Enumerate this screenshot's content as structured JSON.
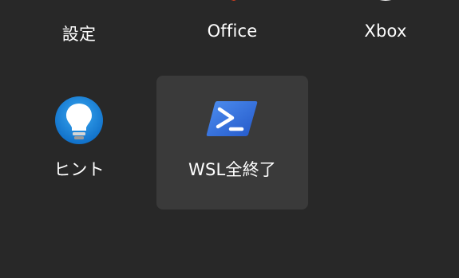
{
  "apps": [
    {
      "label": "設定",
      "icon": "settings-gear-icon"
    },
    {
      "label": "Office",
      "icon": "office-icon"
    },
    {
      "label": "Xbox",
      "icon": "xbox-icon"
    },
    {
      "label": "ヒント",
      "icon": "tips-lightbulb-icon"
    },
    {
      "label": "WSL全終了",
      "icon": "powershell-icon"
    }
  ],
  "colors": {
    "background": "#282828",
    "selected_tile": "#3a3a3a",
    "tips_blue": "#1a8fe0",
    "powershell_blue": "#2f6fdc",
    "office_red": "#e0411f"
  }
}
